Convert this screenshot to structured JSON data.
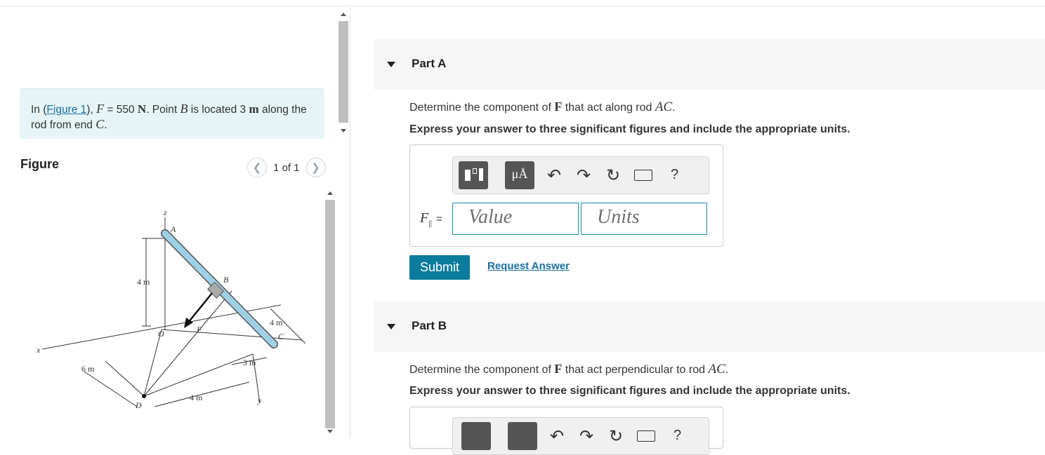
{
  "intro": {
    "pre": "In (",
    "figure_link": "Figure 1",
    "mid1": "), ",
    "F": "F",
    "eq": " = 550 ",
    "N": "N",
    "mid2": ". Point ",
    "B": "B",
    "mid3": " is located 3 ",
    "m": "m",
    "mid4": " along the rod from end ",
    "C": "C",
    "end": "."
  },
  "figure_panel": {
    "title": "Figure",
    "pager": "1 of 1",
    "prev_icon": "chevron-left-icon",
    "next_icon": "chevron-right-icon"
  },
  "diagram_labels": {
    "z": "z",
    "A": "A",
    "B": "B",
    "C": "C",
    "D": "D",
    "O": "O",
    "F": "F",
    "x": "x",
    "y": "y",
    "dim_4m_vertical": "4 m",
    "dim_4m_right": "4 m",
    "dim_3m": "3 m",
    "dim_6m": "6 m",
    "dim_4m_bottom": "4 m"
  },
  "partA": {
    "label": "Part A",
    "q_pre": "Determine the component of ",
    "q_F": "F",
    "q_mid": " that act along rod ",
    "q_rod": "AC",
    "q_end": ".",
    "instruction": "Express your answer to three significant figures and include the appropriate units.",
    "eq_var": "F",
    "eq_sub": "||",
    "eq_sign": "=",
    "value_placeholder": "Value",
    "units_placeholder": "Units",
    "submit": "Submit",
    "request": "Request Answer",
    "toolbar": {
      "units_symbol": "μÅ",
      "help": "?",
      "tools": [
        "templates-icon",
        "units-icon",
        "undo-icon",
        "redo-icon",
        "reset-icon",
        "keyboard-icon",
        "help-icon"
      ]
    }
  },
  "partB": {
    "label": "Part B",
    "q_pre": "Determine the component of ",
    "q_F": "F",
    "q_mid": " that act perpendicular to rod ",
    "q_rod": "AC",
    "q_end": ".",
    "instruction": "Express your answer to three significant figures and include the appropriate units.",
    "toolbar": {
      "help": "?"
    }
  },
  "colors": {
    "accent": "#0b7c9c",
    "link": "#1a6fa1",
    "intro_bg": "#e6f4f6",
    "rod": "#9fd0e6"
  }
}
